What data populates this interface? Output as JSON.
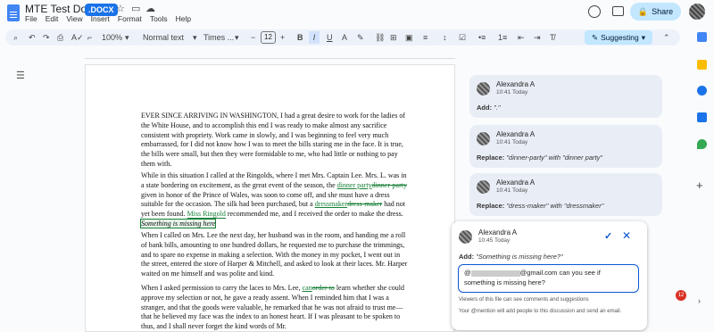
{
  "title_bar": {
    "doc_title": "MTE Test Docs",
    "badge": ".DOCX",
    "star_icon": "star-icon",
    "move_icon": "folder-move-icon",
    "cloud_icon": "cloud-icon",
    "share_label": "Share"
  },
  "menu": [
    "File",
    "Edit",
    "View",
    "Insert",
    "Format",
    "Tools",
    "Help"
  ],
  "toolbar": {
    "zoom": "100%",
    "style": "Normal text",
    "font": "Times ...",
    "font_size": "12",
    "mode": "Suggesting"
  },
  "document": {
    "p1": "EVER SINCE ARRIVING IN WASHINGTON, I had a great desire to work for the ladies of the White House, and to accomplish this end I was ready to make almost any sacrifice consistent with propriety. Work came in slowly, and I was beginning to feel very much embarrassed, for I did not know how I was to meet the bills staring me in the face. It is true, the bills were small, but then they were formidable to me, who had little or nothing to pay them with.",
    "p2_a": "While in this situation I called at the Ringolds, where I met Mrs. Captain Lee. Mrs. L. was in a state bordering on excitement, as the great event of the season, the ",
    "p2_ins1": "dinner party",
    "p2_del1": "dinner-party",
    "p2_b": " given in honor of the Prince of Wales, was soon to come off, and she must have a dress suitable for the occasion. The silk had been purchased, but a ",
    "p2_ins2": "dressmaker",
    "p2_del2": "dress-maker",
    "p2_c": " had not yet been found. ",
    "p2_sug": "Miss Ringold",
    "p2_d": " recommended me, and I received the order to make the dress. ",
    "p2_hl": "Something is missing here",
    "p3": "When I called on Mrs. Lee the next day, her husband was in the room, and handing me a roll of bank bills, amounting to one hundred dollars, he requested me to purchase the trimmings, and to spare no expense in making a selection. With the money in my pocket, I went out in the street, entered the store of Harper & Mitchell, and asked to look at their laces. Mr. Harper waited on me himself and was polite and kind.",
    "p4_a": "When I asked permission to carry the laces to Mrs. Lee, ",
    "p4_ins": "can",
    "p4_del": "order to",
    "p4_b": " learn whether she could approve my selection or not, he gave a ready assent. When I reminded him that I was a stranger, and that the goods were valuable, he remarked that he was not afraid to trust me—that he believed my face was the index to an honest heart. If I was pleasant to be spoken to thus, and I shall never forget the kind words of Mr."
  },
  "comments": [
    {
      "name": "Alexandra A",
      "time": "10:41 Today",
      "action": "Add:",
      "detail": "\".\""
    },
    {
      "name": "Alexandra A",
      "time": "10:41 Today",
      "action": "Replace:",
      "detail": "\"dinner-party\" with \"dinner party\""
    },
    {
      "name": "Alexandra A",
      "time": "10:41 Today",
      "action": "Replace:",
      "detail": "\"dress-maker\" with \"dressmaker\""
    }
  ],
  "active_comment": {
    "name": "Alexandra A",
    "time": "10:45 Today",
    "action": "Add:",
    "detail": "\"Something is missing here?\"",
    "reply_prefix": "@",
    "reply_text": "@gmail.com can you see if something is missing here?",
    "note1": "Viewers of this file can see comments and suggestions",
    "note2": "Your @mention will add people to this discussion and send an email."
  },
  "notification_count": "12"
}
